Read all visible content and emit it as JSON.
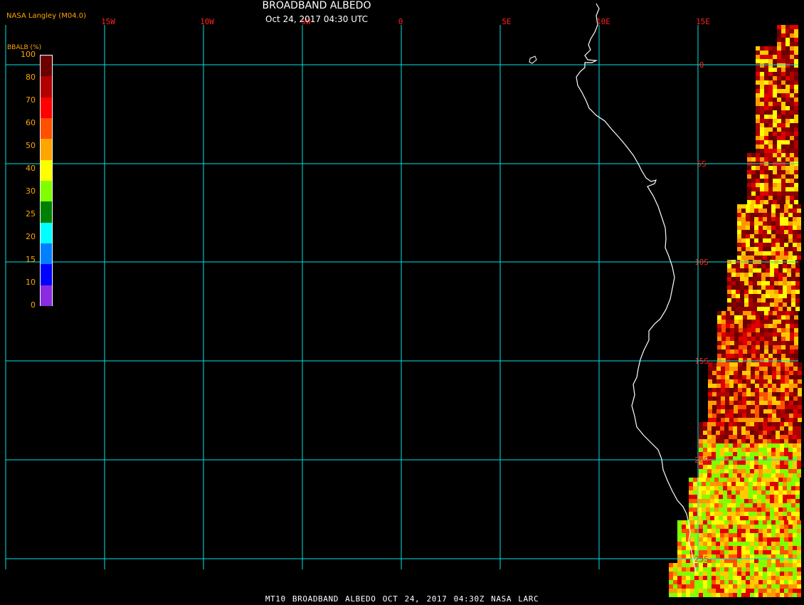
{
  "header": {
    "org": "NASA Langley (M04.0)",
    "title": "BROADBAND ALBEDO",
    "subtitle": "Oct 24, 2017 04:30 UTC"
  },
  "footer": {
    "text": "MT10  BROADBAND ALBEDO   OCT 24, 2017 04:30Z   NASA LARC"
  },
  "colorbar": {
    "title": "BBALB (%)",
    "labels": [
      "100",
      "80",
      "70",
      "60",
      "50",
      "40",
      "30",
      "25",
      "20",
      "15",
      "10",
      "0"
    ],
    "colors": [
      "#6b0000",
      "#b00000",
      "#ff0000",
      "#ff5000",
      "#ffa500",
      "#ffff00",
      "#80ff00",
      "#008000",
      "#00ffff",
      "#0080ff",
      "#0000ff",
      "#8a2be2"
    ]
  },
  "map": {
    "lon_labels": [
      "15W",
      "10W",
      "5W",
      "0",
      "5E",
      "10E",
      "15E"
    ],
    "lat_labels": [
      "0",
      "5S",
      "10S",
      "15S",
      "20S",
      "25S"
    ],
    "colors": {
      "grid": "#00e5e5",
      "coast": "#ffffff",
      "label": "#ff2020"
    },
    "data_colors": [
      "#6b0000",
      "#8b0000",
      "#b00000",
      "#e00000",
      "#ff5000",
      "#ff9900",
      "#ffcc00",
      "#ffff00",
      "#80ff00"
    ]
  }
}
